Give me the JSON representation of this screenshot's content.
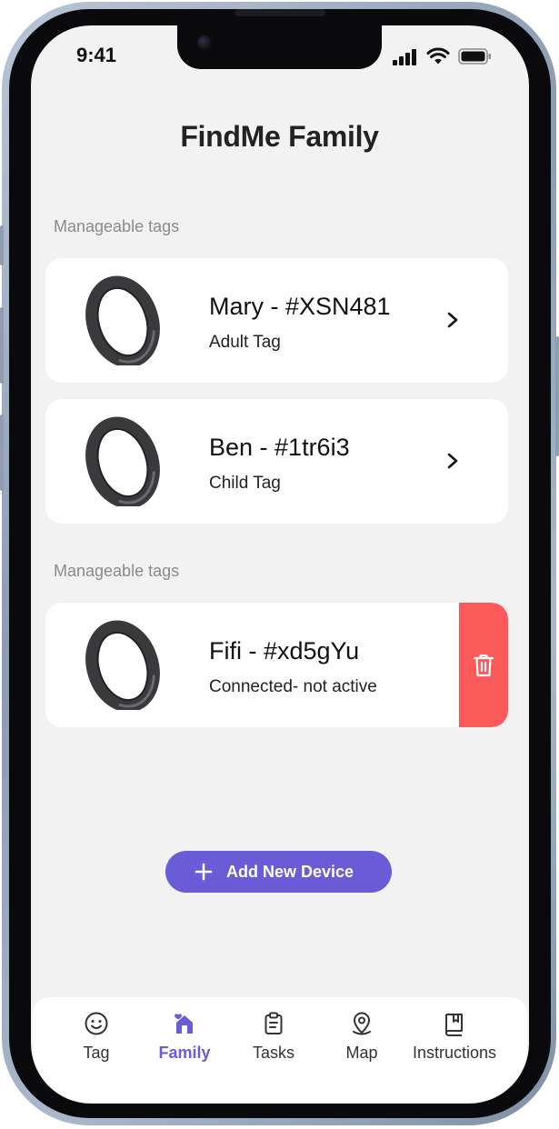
{
  "status_bar": {
    "time": "9:41"
  },
  "app": {
    "title": "FindMe Family"
  },
  "sections": [
    {
      "label": "Manageable tags",
      "tags": [
        {
          "name": "Mary - #XSN481",
          "subtitle": "Adult Tag"
        },
        {
          "name": "Ben - #1tr6i3",
          "subtitle": "Child Tag"
        }
      ]
    },
    {
      "label": "Manageable tags",
      "tags": [
        {
          "name": "Fifi - #xd5gYu",
          "subtitle": "Connected- not active"
        }
      ]
    }
  ],
  "add_device": {
    "label": "Add New Device"
  },
  "bottom_nav": {
    "active": "Family",
    "items": [
      {
        "label": "Tag",
        "icon": "smiley-icon"
      },
      {
        "label": "Family",
        "icon": "house-heart-icon"
      },
      {
        "label": "Tasks",
        "icon": "clipboard-icon"
      },
      {
        "label": "Map",
        "icon": "map-pin-icon"
      },
      {
        "label": "Instructions",
        "icon": "book-icon"
      }
    ]
  },
  "colors": {
    "accent": "#6b5bd6",
    "delete": "#fa5a5a",
    "background": "#f2f2f2",
    "card": "#ffffff"
  }
}
